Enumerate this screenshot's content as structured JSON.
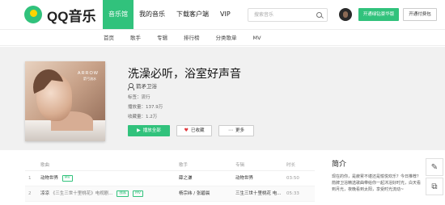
{
  "header": {
    "logo_text": "QQ音乐",
    "nav": [
      "音乐馆",
      "我的音乐",
      "下载客户端",
      "VIP"
    ],
    "search_placeholder": "搜索音乐",
    "btn_green": "开通绿钻豪华版",
    "btn_outline": "开通付费包"
  },
  "subnav": [
    "首页",
    "歌手",
    "专辑",
    "排行榜",
    "分类歌单",
    "MV"
  ],
  "playlist": {
    "cover_text": "ARROW",
    "cover_subtext": "箭弓流水",
    "title": "洗澡必听，浴室好声音",
    "creator": "箭矛卫浴",
    "tag_line": "标签：流行",
    "play_count": "播放量：137.9万",
    "fav_count": "收藏量：1.2万",
    "actions": {
      "play": "播放全部",
      "fav": "已收藏",
      "more": "更多"
    }
  },
  "songlist": {
    "headers": [
      "歌曲",
      "歌手",
      "专辑",
      "时长"
    ],
    "rows": [
      {
        "num": "1",
        "song": "动物世界",
        "tags": [
          "MV"
        ],
        "artist": "薛之谦",
        "album": "动物世界",
        "duration": "03:50"
      },
      {
        "num": "2",
        "song": "凉凉",
        "song_note": "《三生三世十里桃花》电视剧...",
        "tags": [
          "独家",
          "MV"
        ],
        "artist": "杨宗纬 / 张碧晨",
        "album": "三生三世十里桃花 电...",
        "duration": "05:33"
      }
    ]
  },
  "intro": {
    "heading": "简介",
    "text": "现在的你，是疲累不堪还是愉悦欢乐？今日推荐？箭牌卫浴精选歌曲带给你一起沐浴好时光，白天看到月光，夜晚看到太阳，享受时光流动~"
  },
  "icons": {
    "edit": "edit-icon",
    "copy": "copy-icon"
  },
  "colors": {
    "brand_green": "#31c27c",
    "heart_red": "#e0393e"
  }
}
